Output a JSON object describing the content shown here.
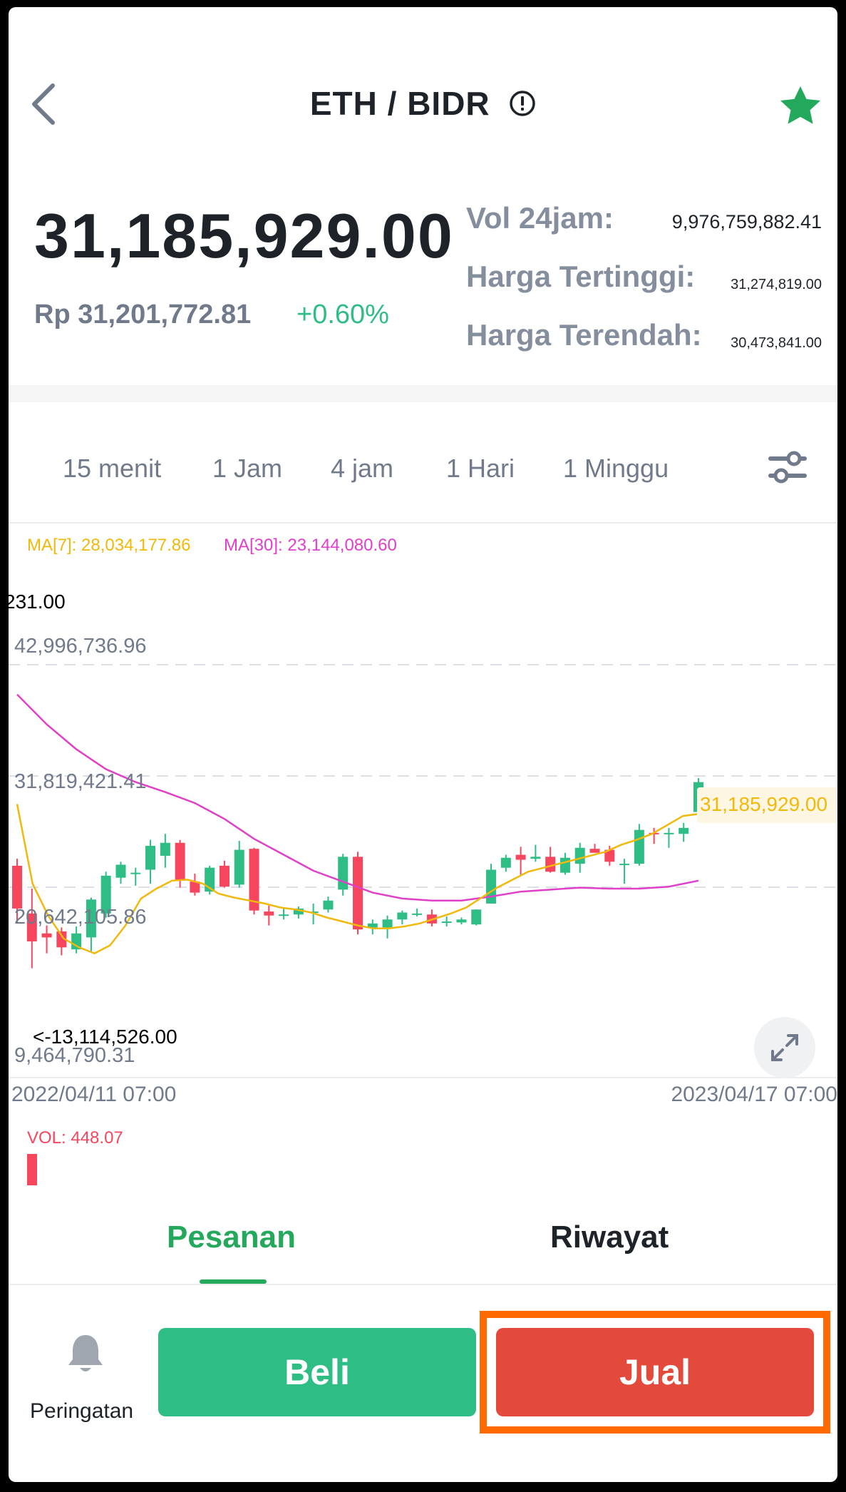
{
  "header": {
    "pair": "ETH / BIDR"
  },
  "ticker": {
    "last_price": "31,185,929.00",
    "price_idr": "Rp 31,201,772.81",
    "change_pct": "+0.60%",
    "stats": [
      {
        "label": "Vol 24jam:",
        "value": "9,976,759,882.41"
      },
      {
        "label": "Harga Tertinggi:",
        "value": "31,274,819.00"
      },
      {
        "label": "Harga Terendah:",
        "value": "30,473,841.00"
      }
    ]
  },
  "intervals": [
    "15 menit",
    "1 Jam",
    "4 jam",
    "1 Hari",
    "1 Minggu"
  ],
  "chart": {
    "ma7_label": "MA[7]: 28,034,177.86",
    "ma30_label": "MA[30]: 23,144,080.60",
    "max_label": "231.00",
    "min_label": "<-13,114,526.00",
    "y_ticks": [
      "42,996,736.96",
      "31,819,421.41",
      "20,642,105.86",
      "9,464,790.31"
    ],
    "last_price_tag": "31,185,929.00",
    "date_start": "2022/04/11 07:00",
    "date_end": "2023/04/17 07:00",
    "volume_label": "VOL: 448.07",
    "colors": {
      "up": "#2ebd85",
      "down": "#f6465d",
      "ma7": "#f0b90b",
      "ma30": "#e040c8"
    }
  },
  "tabs": [
    {
      "label": "Pesanan",
      "active": true
    },
    {
      "label": "Riwayat",
      "active": false
    }
  ],
  "actions": {
    "alert_label": "Peringatan",
    "buy_label": "Beli",
    "sell_label": "Jual"
  },
  "colors": {
    "green": "#2ebd85",
    "red": "#e34a3c",
    "highlight": "#ff6a00",
    "star": "#23a85c"
  },
  "chart_data": {
    "type": "candlestick",
    "x_start": "2022/04/11 07:00",
    "x_end": "2023/04/17 07:00",
    "ylim": [
      9464790.31,
      42996736.96
    ],
    "y_ticks": [
      42996736.96,
      31819421.41,
      20642105.86,
      9464790.31
    ],
    "candles": [
      {
        "o": 22800000,
        "h": 23500000,
        "l": 17000000,
        "c": 18500000
      },
      {
        "o": 18000000,
        "h": 20500000,
        "l": 12500000,
        "c": 15200000
      },
      {
        "o": 16000000,
        "h": 16800000,
        "l": 14000000,
        "c": 15600000
      },
      {
        "o": 16200000,
        "h": 16600000,
        "l": 13800000,
        "c": 14600000
      },
      {
        "o": 14400000,
        "h": 16700000,
        "l": 14000000,
        "c": 16000000
      },
      {
        "o": 15600000,
        "h": 19600000,
        "l": 14200000,
        "c": 19400000
      },
      {
        "o": 18000000,
        "h": 22200000,
        "l": 17600000,
        "c": 21800000
      },
      {
        "o": 21600000,
        "h": 23200000,
        "l": 21000000,
        "c": 22900000
      },
      {
        "o": 22000000,
        "h": 22600000,
        "l": 20800000,
        "c": 22100000
      },
      {
        "o": 22400000,
        "h": 25400000,
        "l": 21000000,
        "c": 24800000
      },
      {
        "o": 23800000,
        "h": 26000000,
        "l": 22600000,
        "c": 25100000
      },
      {
        "o": 25100000,
        "h": 25400000,
        "l": 20600000,
        "c": 21300000
      },
      {
        "o": 21200000,
        "h": 22000000,
        "l": 19800000,
        "c": 20100000
      },
      {
        "o": 20200000,
        "h": 22800000,
        "l": 19900000,
        "c": 22600000
      },
      {
        "o": 22800000,
        "h": 23300000,
        "l": 20600000,
        "c": 20700000
      },
      {
        "o": 20900000,
        "h": 25300000,
        "l": 20600000,
        "c": 24400000
      },
      {
        "o": 24500000,
        "h": 24600000,
        "l": 17900000,
        "c": 18300000
      },
      {
        "o": 18200000,
        "h": 18800000,
        "l": 16800000,
        "c": 17800000
      },
      {
        "o": 17900000,
        "h": 18500000,
        "l": 17400000,
        "c": 17900000
      },
      {
        "o": 17900000,
        "h": 18700000,
        "l": 17500000,
        "c": 18500000
      },
      {
        "o": 18100000,
        "h": 19000000,
        "l": 16900000,
        "c": 18200000
      },
      {
        "o": 18400000,
        "h": 19700000,
        "l": 18100000,
        "c": 19300000
      },
      {
        "o": 20400000,
        "h": 24000000,
        "l": 19800000,
        "c": 23700000
      },
      {
        "o": 23700000,
        "h": 24200000,
        "l": 15900000,
        "c": 16400000
      },
      {
        "o": 16600000,
        "h": 17400000,
        "l": 15900000,
        "c": 17000000
      },
      {
        "o": 16600000,
        "h": 17800000,
        "l": 15500000,
        "c": 17400000
      },
      {
        "o": 17400000,
        "h": 18300000,
        "l": 16900000,
        "c": 18100000
      },
      {
        "o": 18000000,
        "h": 18500000,
        "l": 17700000,
        "c": 18000000
      },
      {
        "o": 17900000,
        "h": 18400000,
        "l": 16700000,
        "c": 17000000
      },
      {
        "o": 17100000,
        "h": 17700000,
        "l": 16700000,
        "c": 17200000
      },
      {
        "o": 17100000,
        "h": 17600000,
        "l": 16900000,
        "c": 17400000
      },
      {
        "o": 16900000,
        "h": 18400000,
        "l": 16800000,
        "c": 18400000
      },
      {
        "o": 19000000,
        "h": 23000000,
        "l": 19000000,
        "c": 22400000
      },
      {
        "o": 22600000,
        "h": 23900000,
        "l": 22200000,
        "c": 23600000
      },
      {
        "o": 23900000,
        "h": 24700000,
        "l": 21900000,
        "c": 23400000
      },
      {
        "o": 23500000,
        "h": 24900000,
        "l": 23200000,
        "c": 23700000
      },
      {
        "o": 23700000,
        "h": 24700000,
        "l": 22100000,
        "c": 22200000
      },
      {
        "o": 22100000,
        "h": 24100000,
        "l": 21900000,
        "c": 23600000
      },
      {
        "o": 23000000,
        "h": 25100000,
        "l": 22100000,
        "c": 24600000
      },
      {
        "o": 24500000,
        "h": 25000000,
        "l": 24200000,
        "c": 24100000
      },
      {
        "o": 24400000,
        "h": 24800000,
        "l": 22800000,
        "c": 23200000
      },
      {
        "o": 23000000,
        "h": 23500000,
        "l": 21000000,
        "c": 23000000
      },
      {
        "o": 23000000,
        "h": 27000000,
        "l": 22800000,
        "c": 26400000
      },
      {
        "o": 26100000,
        "h": 26600000,
        "l": 25000000,
        "c": 26000000
      },
      {
        "o": 26000000,
        "h": 26600000,
        "l": 24600000,
        "c": 26100000
      },
      {
        "o": 26000000,
        "h": 27100000,
        "l": 25200000,
        "c": 26600000
      },
      {
        "o": 28200000,
        "h": 31600000,
        "l": 28000000,
        "c": 31200000
      }
    ],
    "ma7": [
      29000000,
      21000000,
      17800000,
      15500000,
      14600000,
      14000000,
      14800000,
      16800000,
      19500000,
      20500000,
      21300000,
      21400000,
      21000000,
      20000000,
      19600000,
      19300000,
      19000000,
      18600000,
      18400000,
      18100000,
      17600000,
      17200000,
      16800000,
      16500000,
      16500000,
      16700000,
      17000000,
      17500000,
      18000000,
      18600000,
      19600000,
      20600000,
      21400000,
      22200000,
      22600000,
      23000000,
      23400000,
      23800000,
      24200000,
      24900000,
      25400000,
      26000000,
      26900000,
      27800000,
      28000000
    ],
    "ma30": [
      40000000,
      37000000,
      34500000,
      32500000,
      31200000,
      30200000,
      29100000,
      27500000,
      25500000,
      23900000,
      22300000,
      21200000,
      20100000,
      19500000,
      19300000,
      19300000,
      19700000,
      20200000,
      20400000,
      20600000,
      20500000,
      20500000,
      20700000,
      21300000
    ]
  }
}
